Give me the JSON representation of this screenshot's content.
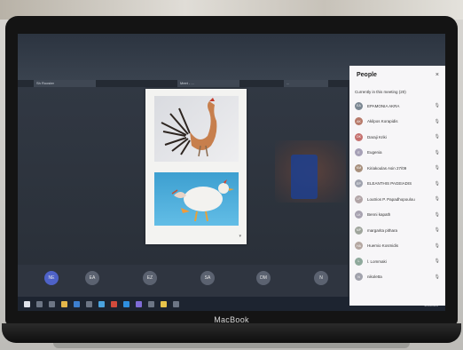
{
  "photo": {
    "laptop_brand": "MacBook"
  },
  "browser": {
    "tabs": [
      {
        "label": "Sh Rooster"
      },
      {
        "label": "Meet - ..."
      },
      {
        "label": "..."
      }
    ]
  },
  "meeting": {
    "participant_tiles": [
      "EA",
      "EZ",
      "SA",
      "DM",
      "N"
    ],
    "self_tile": "NE",
    "taskbar_time": "8:27 PM",
    "taskbar_date": "4/1/2020"
  },
  "people_panel": {
    "title": "People",
    "subtitle": "Currently in this meeting (20)",
    "participants": [
      {
        "initials": "EA",
        "name": "EPAMONIA AKRA",
        "color": "#7b8792"
      },
      {
        "initials": "AK",
        "name": "Akilpos Korapidis",
        "color": "#b77a6a"
      },
      {
        "initials": "DK",
        "name": "Daraji Kriki",
        "color": "#c5706e"
      },
      {
        "initials": "E",
        "name": "Eugenia",
        "color": "#a6a0b6"
      },
      {
        "initials": "KM",
        "name": "Kiriakoulas Asin 27/09",
        "color": "#a78f7c"
      },
      {
        "initials": "EP",
        "name": "ELEANTHIS PAGEIADIS",
        "color": "#9fa2ae"
      },
      {
        "initials": "LP",
        "name": "Loutrios P. Papadhopoulou",
        "color": "#b1a4a6"
      },
      {
        "initials": "LK",
        "name": "Benni kapath",
        "color": "#a7a2b0"
      },
      {
        "initials": "MP",
        "name": "margarita pithara",
        "color": "#9fa59c"
      },
      {
        "initials": "HA",
        "name": "Huemio Kosmidis",
        "color": "#b4a7a1"
      },
      {
        "initials": "L",
        "name": "l. Lommaki",
        "color": "#8fa99c"
      },
      {
        "initials": "N",
        "name": "nikoletta",
        "color": "#a1a2ac"
      }
    ]
  },
  "colors": {
    "panel_bg": "#f7f6f8",
    "stage_bg": "#2a3039",
    "self_avatar": "#4e62c8"
  }
}
